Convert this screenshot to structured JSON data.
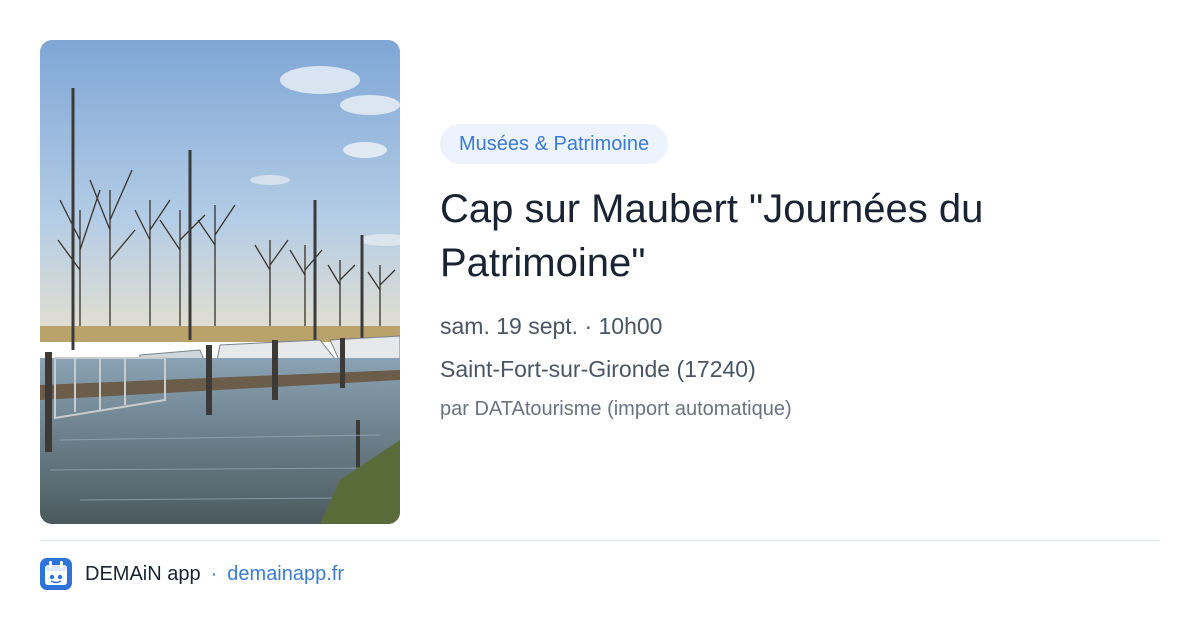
{
  "event": {
    "category": "Musées & Patrimoine",
    "title": "Cap sur Maubert \"Journées du Patrimoine\"",
    "datetime": "sam. 19 sept. · 10h00",
    "location": "Saint-Fort-sur-Gironde (17240)",
    "organizer": "par DATAtourisme (import automatique)"
  },
  "footer": {
    "app_name": "DEMAiN app",
    "separator": "·",
    "domain": "demainapp.fr"
  },
  "colors": {
    "accent": "#3b7bd4",
    "badge_bg": "#edf3fc",
    "title": "#1a2332",
    "divider": "#dde6ee"
  },
  "icons": {
    "app": "demain-app-icon"
  }
}
